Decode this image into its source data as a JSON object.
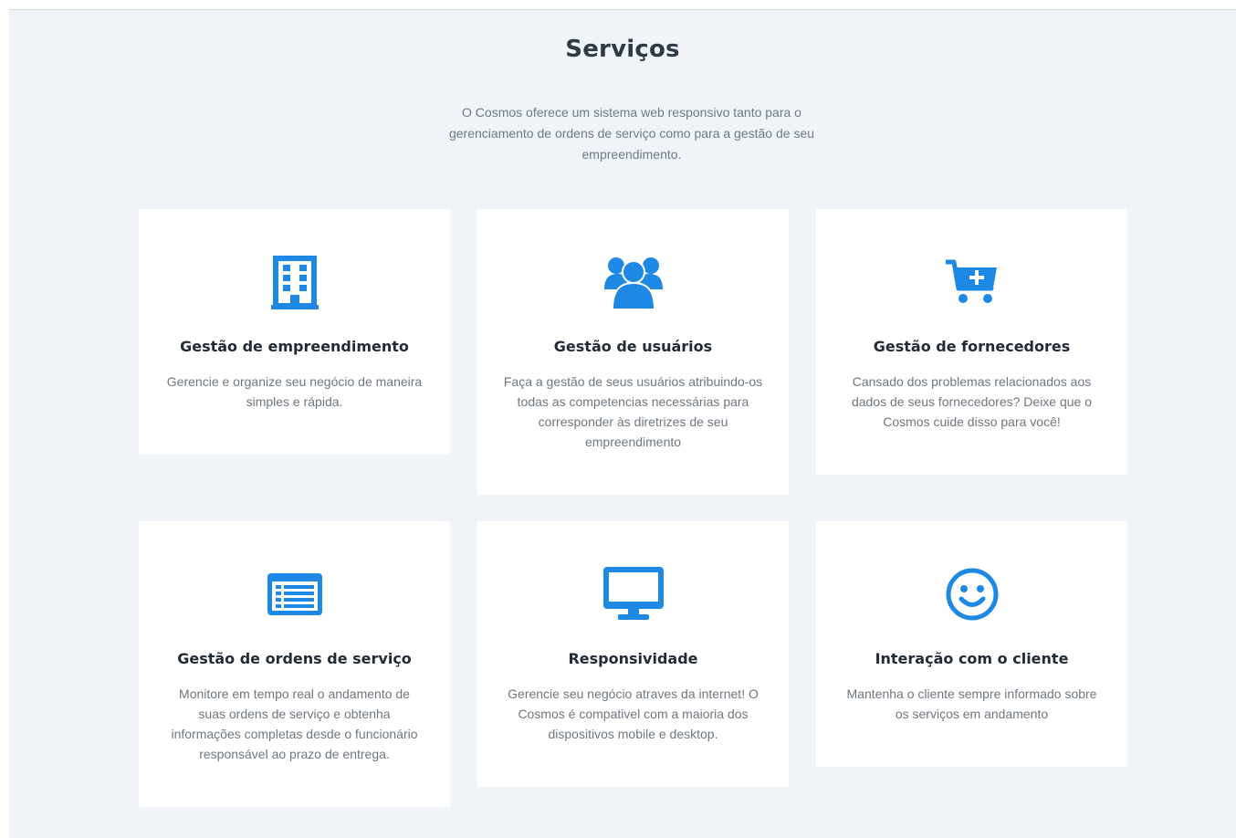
{
  "section": {
    "title": "Serviços",
    "description": "O Cosmos oferece um sistema web responsivo tanto para o gerenciamento de ordens de serviço como para a gestão de seu empreendimento."
  },
  "colors": {
    "accent": "#1e88e5",
    "background": "#f0f4f9",
    "card": "#ffffff"
  },
  "services": [
    {
      "icon": "building-icon",
      "title": "Gestão de empreendimento",
      "description": "Gerencie e organize seu negócio de maneira simples e rápida."
    },
    {
      "icon": "users-icon",
      "title": "Gestão de usuários",
      "description": "Faça a gestão de seus usuários atribuindo-os todas as competencias necessárias para corresponder às diretrizes de seu empreendimento"
    },
    {
      "icon": "cart-plus-icon",
      "title": "Gestão de fornecedores",
      "description": "Cansado dos problemas relacionados aos dados de seus fornecedores? Deixe que o Cosmos cuide disso para você!"
    },
    {
      "icon": "list-alt-icon",
      "title": "Gestão de ordens de serviço",
      "description": "Monitore em tempo real o andamento de suas ordens de serviço e obtenha informações completas desde o funcionário responsável ao prazo de entrega."
    },
    {
      "icon": "desktop-icon",
      "title": "Responsividade",
      "description": "Gerencie seu negócio atraves da internet! O Cosmos é compativel com a maioria dos dispositivos mobile e desktop."
    },
    {
      "icon": "smile-icon",
      "title": "Interação com o cliente",
      "description": "Mantenha o cliente sempre informado sobre os serviços em andamento"
    }
  ]
}
